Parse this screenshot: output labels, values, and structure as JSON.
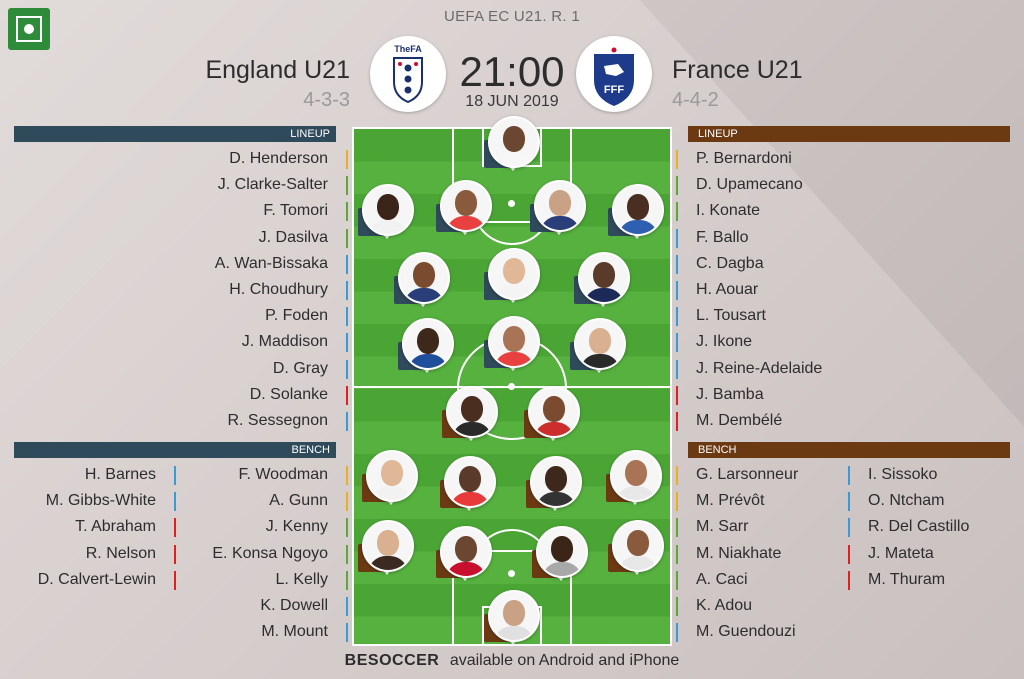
{
  "competition": "UEFA EC U21. R. 1",
  "match": {
    "time": "21:00",
    "date": "18 JUN 2019",
    "home": {
      "name": "England U21",
      "formation": "4-3-3",
      "crest_text": "TheFA"
    },
    "away": {
      "name": "France U21",
      "formation": "4-4-2",
      "crest_text": "FFF"
    }
  },
  "labels": {
    "lineup": "LINEUP",
    "bench": "BENCH"
  },
  "home_lineup": [
    {
      "name": "D. Henderson",
      "pos": "gk"
    },
    {
      "name": "J. Clarke-Salter",
      "pos": "def"
    },
    {
      "name": "F. Tomori",
      "pos": "def"
    },
    {
      "name": "J. Dasilva",
      "pos": "def"
    },
    {
      "name": "A. Wan-Bissaka",
      "pos": "mid"
    },
    {
      "name": "H. Choudhury",
      "pos": "mid"
    },
    {
      "name": "P. Foden",
      "pos": "mid"
    },
    {
      "name": "J. Maddison",
      "pos": "mid"
    },
    {
      "name": "D. Gray",
      "pos": "mid"
    },
    {
      "name": "D. Solanke",
      "pos": "fwd"
    },
    {
      "name": "R. Sessegnon",
      "pos": "mid"
    }
  ],
  "away_lineup": [
    {
      "name": "P.  Bernardoni",
      "pos": "gk"
    },
    {
      "name": "D. Upamecano",
      "pos": "def"
    },
    {
      "name": "I. Konate",
      "pos": "def"
    },
    {
      "name": "F. Ballo",
      "pos": "mid"
    },
    {
      "name": "C. Dagba",
      "pos": "mid"
    },
    {
      "name": "H. Aouar",
      "pos": "mid"
    },
    {
      "name": "L. Tousart",
      "pos": "mid"
    },
    {
      "name": "J. Ikone",
      "pos": "mid"
    },
    {
      "name": "J. Reine-Adelaide",
      "pos": "mid"
    },
    {
      "name": "J. Bamba",
      "pos": "fwd"
    },
    {
      "name": "M. Dembélé",
      "pos": "fwd"
    }
  ],
  "home_bench_col1": [
    {
      "name": "H. Barnes",
      "pos": "mid"
    },
    {
      "name": "M. Gibbs-White",
      "pos": "mid"
    },
    {
      "name": "T. Abraham",
      "pos": "fwd"
    },
    {
      "name": "R. Nelson",
      "pos": "fwd"
    },
    {
      "name": "D. Calvert-Lewin",
      "pos": "fwd"
    }
  ],
  "home_bench_col2": [
    {
      "name": "F. Woodman",
      "pos": "gk"
    },
    {
      "name": "A. Gunn",
      "pos": "gk"
    },
    {
      "name": "J. Kenny",
      "pos": "def"
    },
    {
      "name": "E. Konsa Ngoyo",
      "pos": "def"
    },
    {
      "name": "L. Kelly",
      "pos": "def"
    },
    {
      "name": "K. Dowell",
      "pos": "mid"
    },
    {
      "name": "M. Mount",
      "pos": "mid"
    }
  ],
  "away_bench_col1": [
    {
      "name": "G. Larsonneur",
      "pos": "gk"
    },
    {
      "name": "M.  Prévôt",
      "pos": "gk"
    },
    {
      "name": "M. Sarr",
      "pos": "def"
    },
    {
      "name": "M. Niakhate",
      "pos": "def"
    },
    {
      "name": "A. Caci",
      "pos": "def"
    },
    {
      "name": "K. Adou",
      "pos": "def"
    },
    {
      "name": "M. Guendouzi",
      "pos": "mid"
    }
  ],
  "away_bench_col2": [
    {
      "name": "I. Sissoko",
      "pos": "mid"
    },
    {
      "name": "O. Ntcham",
      "pos": "mid"
    },
    {
      "name": "R. Del Castillo",
      "pos": "mid"
    },
    {
      "name": "J. Mateta",
      "pos": "fwd"
    },
    {
      "name": "M. Thuram",
      "pos": "fwd"
    }
  ],
  "position_colors": {
    "gk": "#e8b020",
    "def": "#5aa83a",
    "mid": "#3a9ad8",
    "fwd": "#e02020"
  },
  "pitch_colors": {
    "home_team": "#2f4a5a",
    "away_team": "#6b3a13"
  },
  "footer": {
    "brand": "BESOCCER",
    "text": "available on Android and iPhone"
  }
}
